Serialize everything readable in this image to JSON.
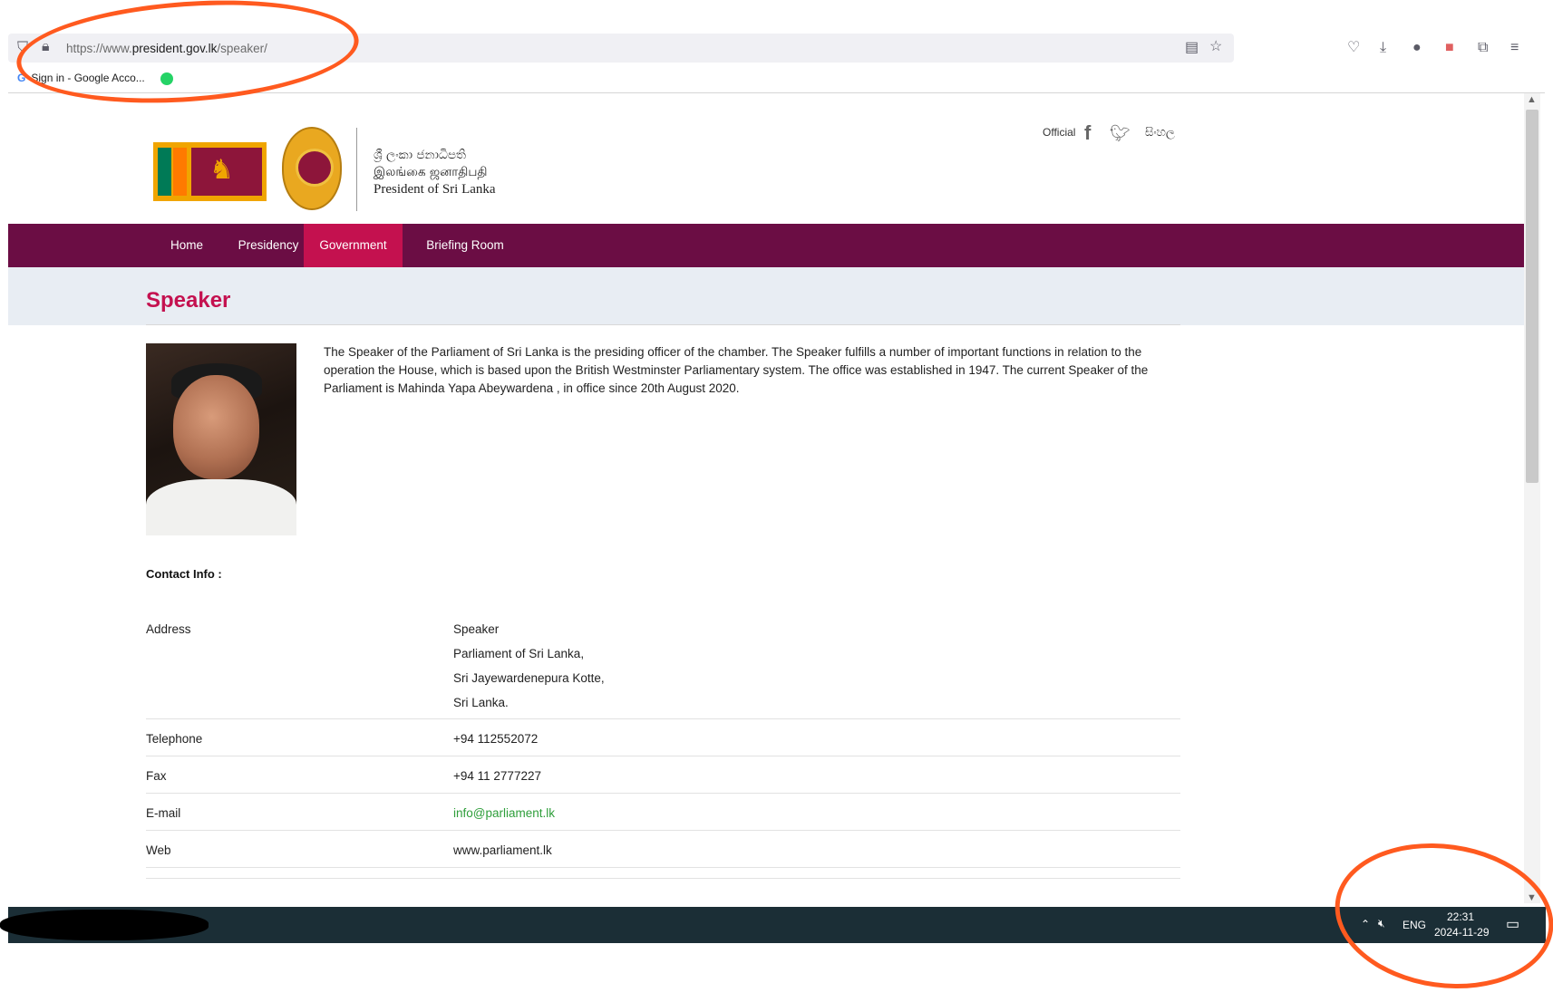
{
  "browser": {
    "url_prefix": "https://www.",
    "url_domain": "president.gov.lk",
    "url_path": "/speaker/",
    "bookmarks": [
      {
        "label": "Sign in - Google Acco...",
        "icon": "google-icon"
      },
      {
        "label": "",
        "icon": "whatsapp-icon"
      }
    ]
  },
  "header": {
    "title_sinhala": "ශ්‍රී ලංකා ජනාධිපති",
    "title_tamil": "இலங்கை ஜனாதிபதி",
    "title_english": "President of Sri Lanka",
    "official_label": "Official",
    "language_label": "සිංහල"
  },
  "nav": {
    "items": [
      {
        "label": "Home",
        "active": false
      },
      {
        "label": "Presidency",
        "active": false
      },
      {
        "label": "Government",
        "active": true
      },
      {
        "label": "Briefing Room",
        "active": false
      }
    ]
  },
  "page": {
    "title": "Speaker",
    "bio": "The Speaker of the Parliament of Sri Lanka is the presiding officer of the chamber. The Speaker fulfills a number of important functions in relation to the operation the House, which is based upon the British Westminster Parliamentary system. The office was established in 1947. The current Speaker of the Parliament is Mahinda Yapa Abeywardena , in office since 20th August 2020."
  },
  "contact": {
    "heading": "Contact Info :",
    "address_label": "Address",
    "address_lines": [
      "Speaker",
      "Parliament of Sri Lanka,",
      "Sri Jayewardenepura Kotte,",
      "Sri Lanka."
    ],
    "telephone_label": "Telephone",
    "telephone": "+94 112552072",
    "fax_label": "Fax",
    "fax": "+94 11 2777227",
    "email_label": "E-mail",
    "email": "info@parliament.lk",
    "web_label": "Web",
    "web": "www.parliament.lk"
  },
  "taskbar": {
    "language": "ENG",
    "time": "22:31",
    "date": "2024-11-29"
  },
  "colors": {
    "nav_bg": "#6b0d44",
    "nav_active": "#c4114f",
    "title_color": "#c4114f",
    "link_green": "#2e9e3a",
    "annotation": "#ff5a1f"
  }
}
